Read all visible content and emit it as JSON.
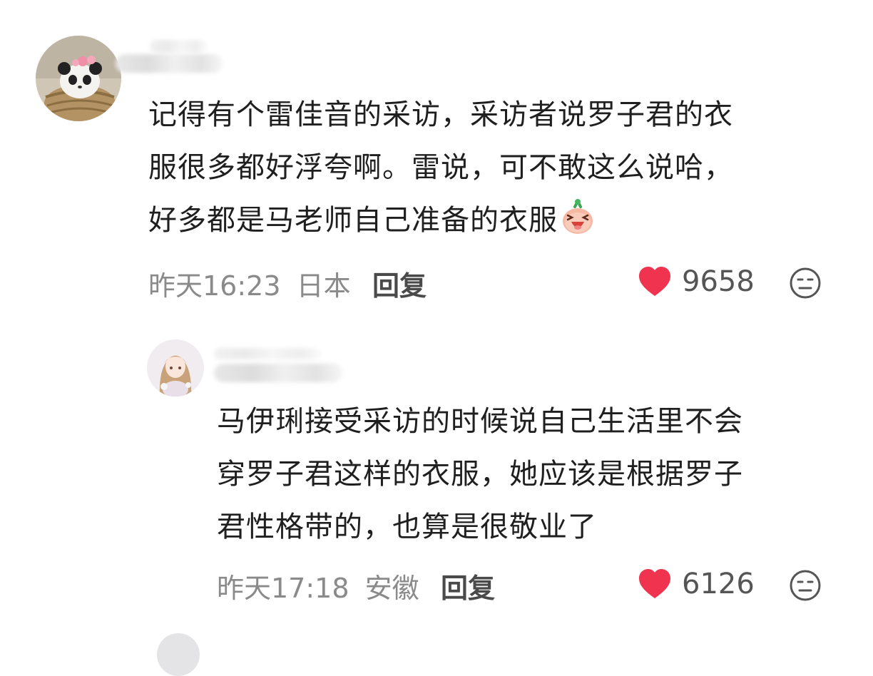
{
  "comments": [
    {
      "text_lines": [
        "记得有个雷佳音的采访，采访者说罗子君的衣",
        "服很多都好浮夸啊。雷说，可不敢这么说哈，",
        "好多都是马老师自己准备的衣服"
      ],
      "timestamp": "昨天16:23",
      "location": "日本",
      "reply_label": "回复",
      "likes": "9658",
      "avatar_icon": "panda-in-basket-avatar",
      "inline_emoji_icon": "laughing-sticker-icon"
    },
    {
      "text_lines": [
        "马伊琍接受采访的时候说自己生活里不会",
        "穿罗子君这样的衣服，她应该是根据罗子",
        "君性格带的，也算是很敬业了"
      ],
      "timestamp": "昨天17:18",
      "location": "安徽",
      "reply_label": "回复",
      "likes": "6126",
      "avatar_icon": "anime-girl-avatar"
    }
  ],
  "colors": {
    "like_heart": "#f0334f",
    "meta_text": "#8a8a8a",
    "body_text": "#1f1f1f"
  }
}
